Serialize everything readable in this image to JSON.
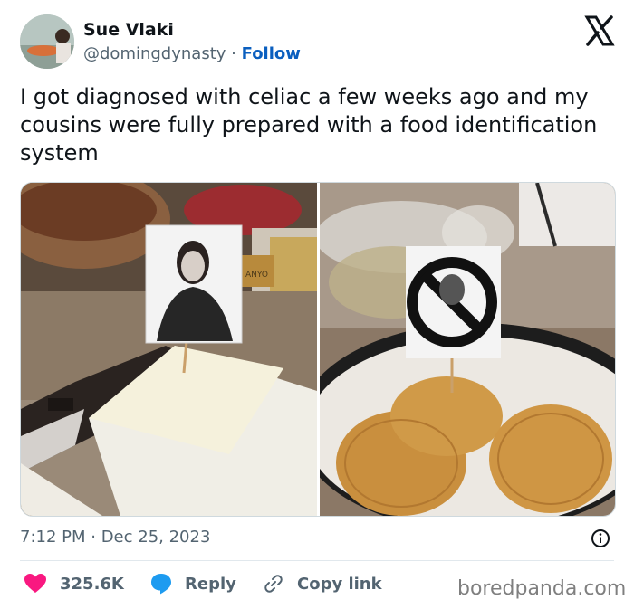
{
  "user": {
    "name": "Sue Vlaki",
    "handle": "@domingdynasty",
    "separator": "·",
    "follow_label": "Follow"
  },
  "tweet": {
    "text": "I got diagnosed with celiac a few weeks ago and my cousins were fully prepared with a food identification system",
    "timestamp": "7:12 PM · Dec 25, 2023"
  },
  "actions": {
    "likes": "325.6K",
    "reply_label": "Reply",
    "copy_label": "Copy link"
  },
  "media": {
    "left_photo": {
      "label_text": "ANYO"
    },
    "right_photo": {}
  },
  "watermark": "boredpanda.com",
  "colors": {
    "like_heart": "#f91880",
    "reply_bubble": "#1d9bf0",
    "follow_link": "#0b5fbf",
    "secondary_text": "#536471"
  },
  "icons": [
    "x-logo-icon",
    "info-icon",
    "heart-icon",
    "reply-bubble-icon",
    "link-icon"
  ]
}
